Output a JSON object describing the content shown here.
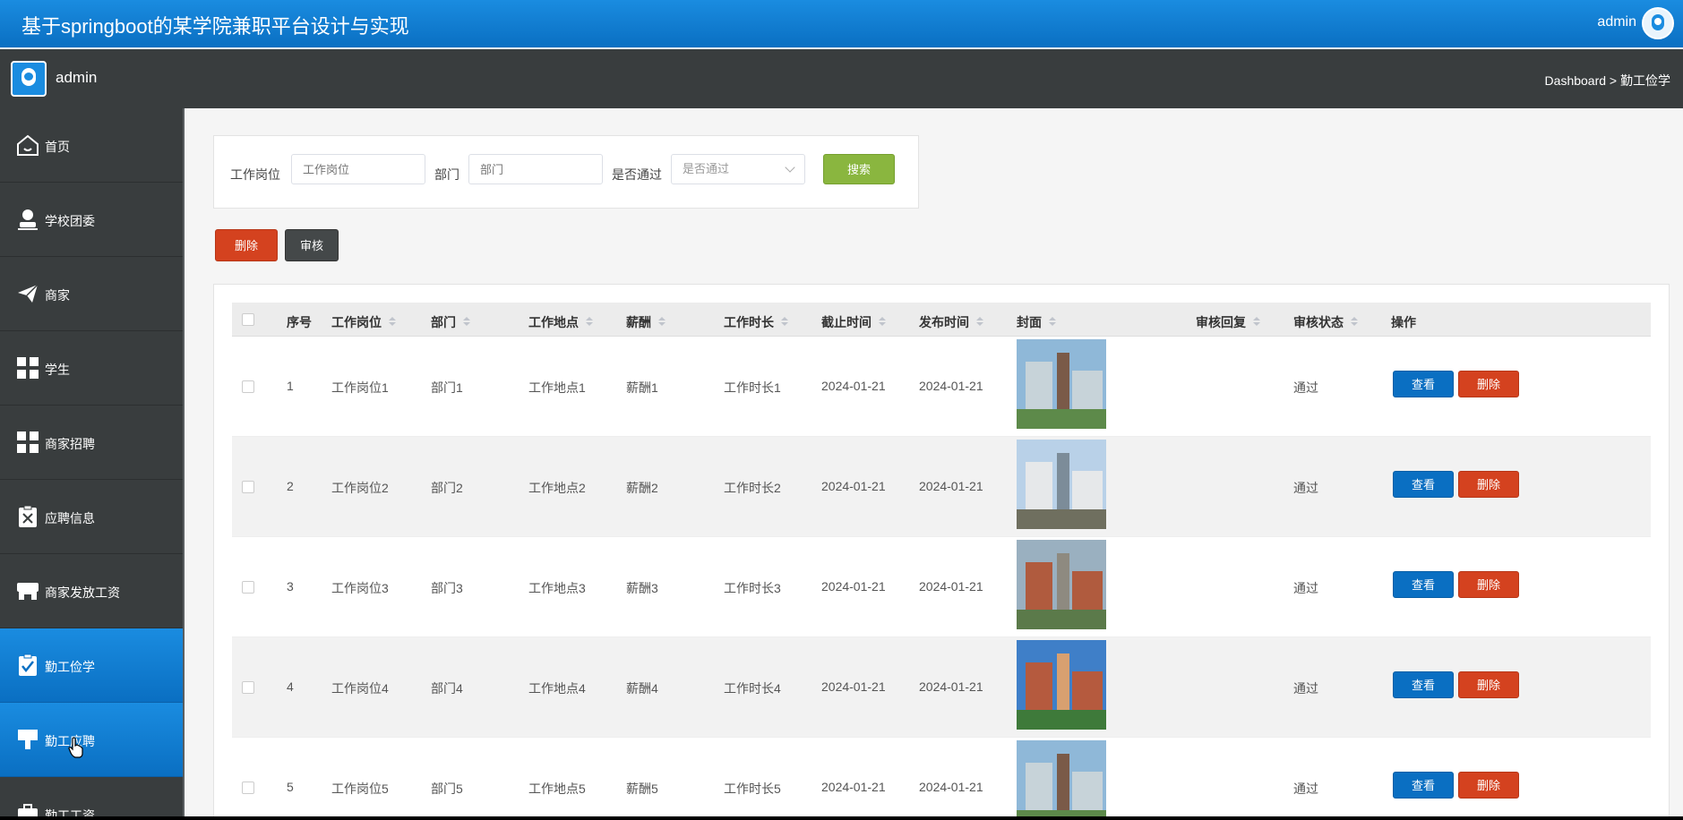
{
  "header": {
    "title": "基于springboot的某学院兼职平台设计与实现",
    "user": "admin"
  },
  "subheader": {
    "admin": "admin",
    "breadcrumb": "Dashboard > 勤工俭学"
  },
  "sidebar": {
    "items": [
      {
        "label": "首页",
        "icon": "home-icon"
      },
      {
        "label": "学校团委",
        "icon": "user-icon"
      },
      {
        "label": "商家",
        "icon": "paper-plane-icon"
      },
      {
        "label": "学生",
        "icon": "grid-icon"
      },
      {
        "label": "商家招聘",
        "icon": "grid-icon"
      },
      {
        "label": "应聘信息",
        "icon": "clipboard-x-icon"
      },
      {
        "label": "商家发放工资",
        "icon": "store-icon"
      },
      {
        "label": "勤工俭学",
        "icon": "clipboard-check-icon",
        "active": true
      },
      {
        "label": "勤工应聘",
        "icon": "brush-icon",
        "active": true
      },
      {
        "label": "勤工工资",
        "icon": "briefcase-icon"
      }
    ]
  },
  "search": {
    "job_label": "工作岗位",
    "job_placeholder": "工作岗位",
    "dept_label": "部门",
    "dept_placeholder": "部门",
    "pass_label": "是否通过",
    "pass_placeholder": "是否通过",
    "search_button": "搜索"
  },
  "actions": {
    "delete": "删除",
    "audit": "审核"
  },
  "table": {
    "headers": [
      "序号",
      "工作岗位",
      "部门",
      "工作地点",
      "薪酬",
      "工作时长",
      "截止时间",
      "发布时间",
      "封面",
      "审核回复",
      "审核状态",
      "操作"
    ],
    "view_label": "查看",
    "delete_label": "删除",
    "rows": [
      {
        "no": "1",
        "job": "工作岗位1",
        "dept": "部门1",
        "place": "工作地点1",
        "pay": "薪酬1",
        "hours": "工作时长1",
        "deadline": "2024-01-21",
        "published": "2024-01-21",
        "reply": "",
        "status": "通过"
      },
      {
        "no": "2",
        "job": "工作岗位2",
        "dept": "部门2",
        "place": "工作地点2",
        "pay": "薪酬2",
        "hours": "工作时长2",
        "deadline": "2024-01-21",
        "published": "2024-01-21",
        "reply": "",
        "status": "通过"
      },
      {
        "no": "3",
        "job": "工作岗位3",
        "dept": "部门3",
        "place": "工作地点3",
        "pay": "薪酬3",
        "hours": "工作时长3",
        "deadline": "2024-01-21",
        "published": "2024-01-21",
        "reply": "",
        "status": "通过"
      },
      {
        "no": "4",
        "job": "工作岗位4",
        "dept": "部门4",
        "place": "工作地点4",
        "pay": "薪酬4",
        "hours": "工作时长4",
        "deadline": "2024-01-21",
        "published": "2024-01-21",
        "reply": "",
        "status": "通过"
      },
      {
        "no": "5",
        "job": "工作岗位5",
        "dept": "部门5",
        "place": "工作地点5",
        "pay": "薪酬5",
        "hours": "工作时长5",
        "deadline": "2024-01-21",
        "published": "2024-01-21",
        "reply": "",
        "status": "通过"
      }
    ]
  },
  "colors": {
    "primary": "#0a6fc2",
    "danger": "#d4421f",
    "success": "#8ab63f",
    "sidebar": "#393d3e"
  }
}
